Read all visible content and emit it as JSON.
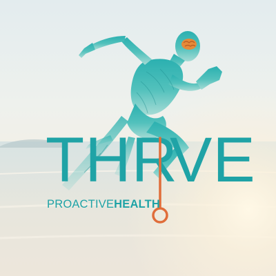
{
  "logo": {
    "word_left": "THR",
    "word_right": "VE",
    "tagline_light": "PROACTIVE",
    "tagline_bold": "HEALTH"
  },
  "colors": {
    "teal": "#1fa3a6",
    "orange": "#e06d3a",
    "sky": "#e3ecee",
    "sand": "#f3efe6"
  },
  "icons": {
    "figure": "running-man-icon",
    "brain": "brain-icon",
    "i_mark": "pin-i-icon"
  }
}
